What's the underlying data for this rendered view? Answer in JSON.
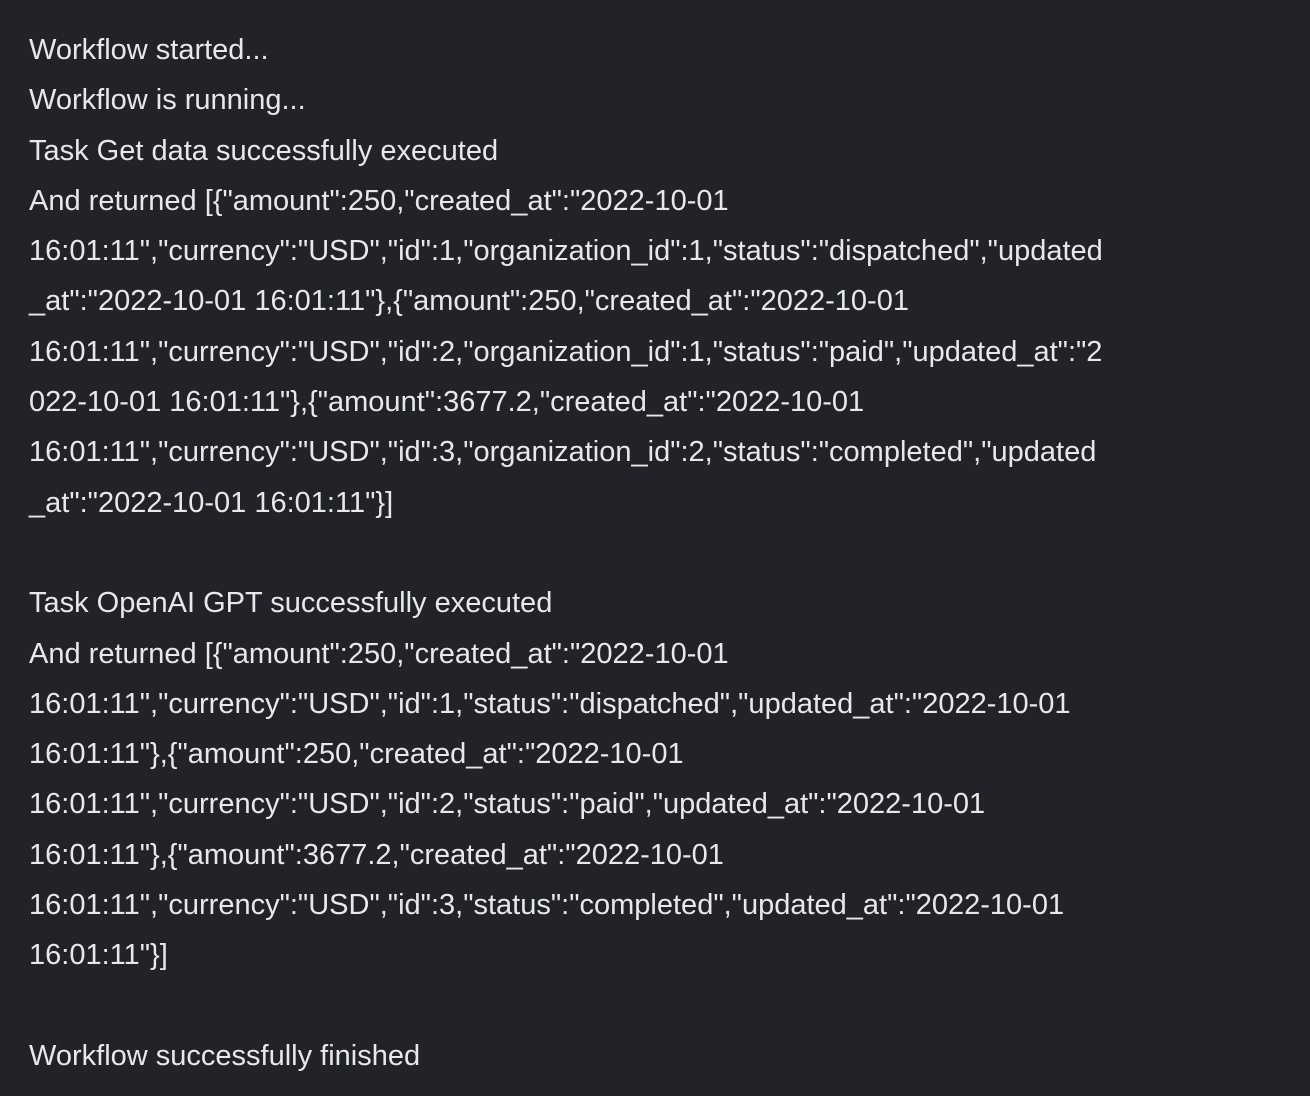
{
  "log": {
    "lines": [
      "Workflow started...",
      "Workflow is running...",
      "Task Get data successfully executed",
      "And returned [{\"amount\":250,\"created_at\":\"2022-10-01",
      "16:01:11\",\"currency\":\"USD\",\"id\":1,\"organization_id\":1,\"status\":\"dispatched\",\"updated",
      "_at\":\"2022-10-01 16:01:11\"},{\"amount\":250,\"created_at\":\"2022-10-01",
      "16:01:11\",\"currency\":\"USD\",\"id\":2,\"organization_id\":1,\"status\":\"paid\",\"updated_at\":\"2",
      "022-10-01 16:01:11\"},{\"amount\":3677.2,\"created_at\":\"2022-10-01",
      "16:01:11\",\"currency\":\"USD\",\"id\":3,\"organization_id\":2,\"status\":\"completed\",\"updated",
      "_at\":\"2022-10-01 16:01:11\"}]",
      "",
      "Task OpenAI GPT successfully executed",
      "And returned [{\"amount\":250,\"created_at\":\"2022-10-01",
      "16:01:11\",\"currency\":\"USD\",\"id\":1,\"status\":\"dispatched\",\"updated_at\":\"2022-10-01",
      "16:01:11\"},{\"amount\":250,\"created_at\":\"2022-10-01",
      "16:01:11\",\"currency\":\"USD\",\"id\":2,\"status\":\"paid\",\"updated_at\":\"2022-10-01",
      "16:01:11\"},{\"amount\":3677.2,\"created_at\":\"2022-10-01",
      "16:01:11\",\"currency\":\"USD\",\"id\":3,\"status\":\"completed\",\"updated_at\":\"2022-10-01",
      "16:01:11\"}]",
      "",
      "Workflow successfully finished"
    ]
  }
}
